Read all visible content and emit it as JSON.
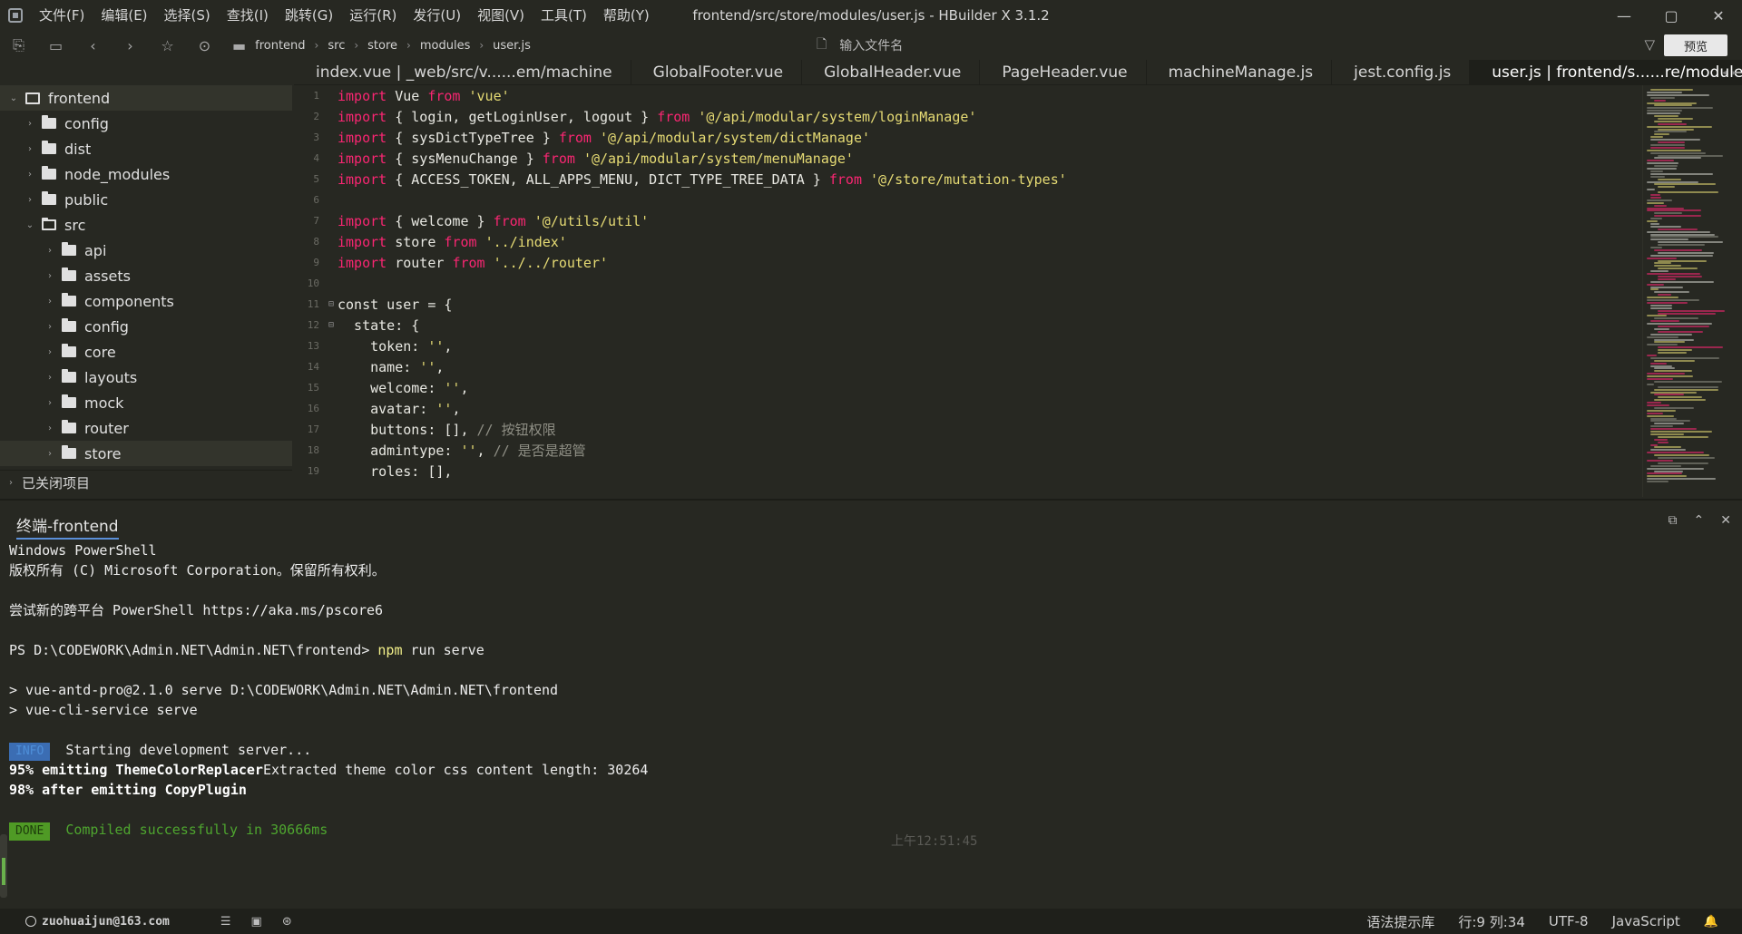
{
  "window": {
    "title": "frontend/src/store/modules/user.js - HBuilder X 3.1.2",
    "menu": [
      "文件(F)",
      "编辑(E)",
      "选择(S)",
      "查找(I)",
      "跳转(G)",
      "运行(R)",
      "发行(U)",
      "视图(V)",
      "工具(T)",
      "帮助(Y)"
    ],
    "controls": {
      "minimize": "—",
      "maximize": "▢",
      "close": "✕"
    }
  },
  "toolbar": {
    "breadcrumb": [
      "frontend",
      "src",
      "store",
      "modules",
      "user.js"
    ],
    "search_placeholder": "输入文件名",
    "preview_label": "预览"
  },
  "sidebar": {
    "root": "frontend",
    "items_level1": [
      "config",
      "dist",
      "node_modules",
      "public",
      "src"
    ],
    "items_src": [
      "api",
      "assets",
      "components",
      "config",
      "core",
      "layouts",
      "mock",
      "router",
      "store"
    ],
    "closed_projects": "已关闭项目"
  },
  "tabs": [
    "index.vue | _web/src/v......em/machine",
    "GlobalFooter.vue",
    "GlobalHeader.vue",
    "PageHeader.vue",
    "machineManage.js",
    "jest.config.js",
    "user.js | frontend/s......re/modules"
  ],
  "editor": {
    "line_numbers": [
      "1",
      "2",
      "3",
      "4",
      "5",
      "6",
      "7",
      "8",
      "9",
      "10",
      "11",
      "12",
      "13",
      "14",
      "15",
      "16",
      "17",
      "18",
      "19"
    ],
    "lines": [
      [
        [
          "kw",
          "import"
        ],
        [
          "t",
          " Vue "
        ],
        [
          "kw",
          "from"
        ],
        [
          "t",
          " "
        ],
        [
          "str",
          "'vue'"
        ]
      ],
      [
        [
          "kw",
          "import"
        ],
        [
          "t",
          " { login, getLoginUser, logout } "
        ],
        [
          "kw",
          "from"
        ],
        [
          "t",
          " "
        ],
        [
          "str",
          "'@/api/modular/system/loginManage'"
        ]
      ],
      [
        [
          "kw",
          "import"
        ],
        [
          "t",
          " { sysDictTypeTree } "
        ],
        [
          "kw",
          "from"
        ],
        [
          "t",
          " "
        ],
        [
          "str",
          "'@/api/modular/system/dictManage'"
        ]
      ],
      [
        [
          "kw",
          "import"
        ],
        [
          "t",
          " { sysMenuChange } "
        ],
        [
          "kw",
          "from"
        ],
        [
          "t",
          " "
        ],
        [
          "str",
          "'@/api/modular/system/menuManage'"
        ]
      ],
      [
        [
          "kw",
          "import"
        ],
        [
          "t",
          " { ACCESS_TOKEN, ALL_APPS_MENU, DICT_TYPE_TREE_DATA } "
        ],
        [
          "kw",
          "from"
        ],
        [
          "t",
          " "
        ],
        [
          "str",
          "'@/store/mutation-types'"
        ]
      ],
      [],
      [
        [
          "kw",
          "import"
        ],
        [
          "t",
          " { welcome } "
        ],
        [
          "kw",
          "from"
        ],
        [
          "t",
          " "
        ],
        [
          "str",
          "'@/utils/util'"
        ]
      ],
      [
        [
          "kw",
          "import"
        ],
        [
          "t",
          " store "
        ],
        [
          "kw",
          "from"
        ],
        [
          "t",
          " "
        ],
        [
          "str",
          "'../index'"
        ]
      ],
      [
        [
          "kw",
          "import"
        ],
        [
          "t",
          " router "
        ],
        [
          "kw",
          "from"
        ],
        [
          "t",
          " "
        ],
        [
          "str",
          "'../../router'"
        ]
      ],
      [],
      [
        [
          "t",
          "const user = {"
        ]
      ],
      [
        [
          "t",
          "  state: {"
        ]
      ],
      [
        [
          "t",
          "    token: "
        ],
        [
          "str",
          "''"
        ],
        [
          "t",
          ","
        ]
      ],
      [
        [
          "t",
          "    name: "
        ],
        [
          "str",
          "''"
        ],
        [
          "t",
          ","
        ]
      ],
      [
        [
          "t",
          "    welcome: "
        ],
        [
          "str",
          "''"
        ],
        [
          "t",
          ","
        ]
      ],
      [
        [
          "t",
          "    avatar: "
        ],
        [
          "str",
          "''"
        ],
        [
          "t",
          ","
        ]
      ],
      [
        [
          "t",
          "    buttons: [], "
        ],
        [
          "cmt",
          "// 按钮权限"
        ]
      ],
      [
        [
          "t",
          "    admintype: "
        ],
        [
          "str",
          "''"
        ],
        [
          "t",
          ", "
        ],
        [
          "cmt",
          "// 是否是超管"
        ]
      ],
      [
        [
          "t",
          "    roles: [],"
        ]
      ]
    ]
  },
  "terminal": {
    "tab_label": "终端-frontend",
    "lines": {
      "l1": "Windows PowerShell",
      "l2": "版权所有 (C) Microsoft Corporation。保留所有权利。",
      "l3": "尝试新的跨平台 PowerShell https://aka.ms/pscore6",
      "prompt": "PS D:\\CODEWORK\\Admin.NET\\Admin.NET\\frontend> ",
      "cmd_npm": "npm",
      "cmd_rest": " run serve",
      "l5": "> vue-antd-pro@2.1.0 serve D:\\CODEWORK\\Admin.NET\\Admin.NET\\frontend",
      "l6": "> vue-cli-service serve",
      "info_badge": "INFO",
      "info_text": " Starting development server...",
      "l8a": "95% emitting ThemeColorReplacer",
      "l8b": "Extracted theme color css content length: 30264",
      "l9": "98% after emitting CopyPlugin",
      "done_badge": "DONE",
      "done_text": " Compiled successfully in 30666ms",
      "time": "上午12:51:45"
    }
  },
  "statusbar": {
    "account": "zuohuaijun@163.com",
    "syntax": "语法提示库",
    "position": "行:9  列:34",
    "encoding": "UTF-8",
    "language": "JavaScript"
  },
  "colors": {
    "keyword": "#f92672",
    "string": "#e6db74",
    "comment": "#8f8f85",
    "background": "#272822"
  }
}
